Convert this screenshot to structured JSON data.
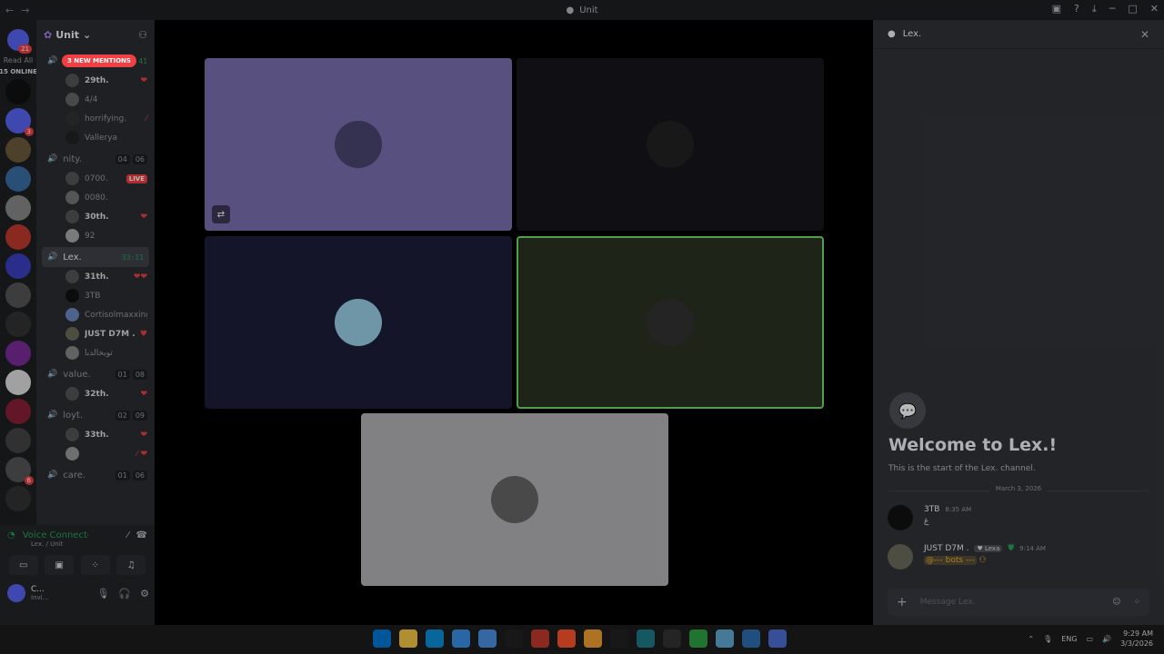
{
  "window": {
    "title": "Unit",
    "back": "←",
    "forward": "→"
  },
  "guilds": {
    "read_all": "Read All",
    "online": "15 ONLINE",
    "dm_badge": "21",
    "icon_colors": [
      "#111",
      "#5865f2",
      "#6b5a3c",
      "#3a6ea5",
      "#888",
      "#c0392b",
      "#3b3fbf",
      "#555",
      "#333",
      "#7a2b9a",
      "#e0e0e0",
      "#8a2035",
      "#444",
      "#555",
      "#333"
    ],
    "badges": [
      "",
      "3",
      "",
      "",
      "",
      "",
      "",
      "",
      "",
      "",
      "",
      "",
      "",
      "6",
      ""
    ]
  },
  "server": {
    "name": "Unit",
    "new_mentions": "3 NEW MENTIONS"
  },
  "channels": [
    {
      "name": "",
      "timer": "41",
      "active": false,
      "counts": [],
      "members": [
        {
          "name": "29th.",
          "bold": true,
          "icon": "❤",
          "color": "#555"
        },
        {
          "name": "4/4",
          "bold": false,
          "icon": "",
          "color": "#666"
        },
        {
          "name": "horrifying.",
          "bold": false,
          "icon": "⁄",
          "color": "#333"
        },
        {
          "name": "Vallerya",
          "bold": false,
          "icon": "",
          "color": "#222"
        }
      ]
    },
    {
      "name": "nity.",
      "active": false,
      "counts": [
        "04",
        "06"
      ],
      "members": [
        {
          "name": "0700.",
          "bold": false,
          "live": "LIVE",
          "icon": "",
          "color": "#555"
        },
        {
          "name": "0080.",
          "bold": false,
          "icon": "",
          "color": "#777"
        },
        {
          "name": "30th.",
          "bold": true,
          "icon": "❤",
          "color": "#555"
        },
        {
          "name": "92",
          "bold": false,
          "icon": "",
          "color": "#aaa"
        }
      ]
    },
    {
      "name": "Lex.",
      "active": true,
      "timer": "33:11",
      "counts": [],
      "members": [
        {
          "name": "31th.",
          "bold": true,
          "icon": "❤❤",
          "color": "#555"
        },
        {
          "name": "3TB",
          "bold": false,
          "icon": "",
          "color": "#111"
        },
        {
          "name": "Cortisolmaxxing",
          "bold": false,
          "icon": "",
          "color": "#6c8ac2"
        },
        {
          "name": "JUST D7M .",
          "bold": true,
          "icon": "♥",
          "color": "#6b6b5a"
        },
        {
          "name": "توبخالدبا",
          "bold": false,
          "icon": "",
          "color": "#888"
        }
      ]
    },
    {
      "name": "value.",
      "active": false,
      "counts": [
        "01",
        "08"
      ],
      "members": [
        {
          "name": "32th.",
          "bold": true,
          "icon": "❤",
          "color": "#555"
        }
      ]
    },
    {
      "name": "loyt.",
      "active": false,
      "counts": [
        "02",
        "09"
      ],
      "members": [
        {
          "name": "33th.",
          "bold": true,
          "icon": "❤",
          "color": "#555"
        },
        {
          "name": "",
          "bold": false,
          "icon": "⁄ ❤",
          "color": "#999"
        }
      ]
    },
    {
      "name": "care.",
      "active": false,
      "counts": [
        "01",
        "06"
      ],
      "members": []
    }
  ],
  "voice": {
    "status": "Voice Connected",
    "sub": "Lex. / Unit"
  },
  "user": {
    "name": "C...",
    "status": "Invi..."
  },
  "tiles": [
    {
      "bg": "#7b6fb0",
      "avatar": "#4a4470",
      "border": ""
    },
    {
      "bg": "#17151b",
      "avatar": "#222",
      "border": ""
    },
    {
      "bg": "#1c1e3a",
      "avatar": "#9ad0e8",
      "border": ""
    },
    {
      "bg": "#2a3220",
      "avatar": "#333",
      "border": "#6fdc6f"
    },
    {
      "bg": "#b3b3b8",
      "avatar": "#666",
      "border": ""
    }
  ],
  "side": {
    "title": "Lex.",
    "welcome": "Welcome to Lex.!",
    "welcome_sub": "This is the start of the Lex. channel.",
    "date": "March 3, 2026",
    "messages": [
      {
        "author": "3TB",
        "time": "8:35 AM",
        "tag": "",
        "body": "غ",
        "avatar": "#111"
      },
      {
        "author": "JUST D7M .",
        "time": "9:14 AM",
        "tag": "♥ Lexa",
        "body": "@--- bots ---",
        "avatar": "#6b6b5a",
        "mention": true
      }
    ],
    "placeholder": "Message Lex."
  },
  "taskbar": {
    "lang": "ENG",
    "time": "9:29 AM",
    "date": "3/3/2026",
    "apps": [
      "#0078d4",
      "#f5c542",
      "#0c8fd6",
      "#3a8ee6",
      "#4a90e2",
      "#222",
      "#c0392b",
      "#fb542b",
      "#f0a030",
      "#222",
      "#1e7a8a",
      "#333",
      "#2ea043",
      "#5fa8d3",
      "#2b6cb0",
      "#4d6dd4"
    ]
  }
}
